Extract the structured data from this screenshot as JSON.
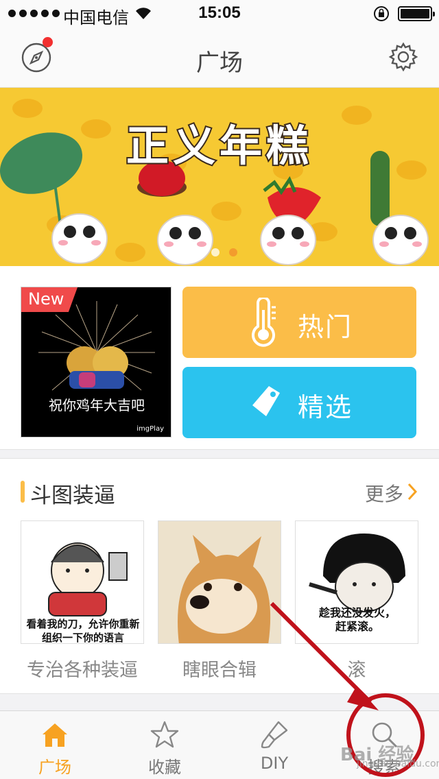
{
  "status_bar": {
    "carrier": "中国电信",
    "time": "15:05"
  },
  "navbar": {
    "title": "广场"
  },
  "banner": {
    "title": "正义年糕",
    "page_count": 3,
    "active_page": 3
  },
  "feature": {
    "new_tag": "New",
    "gif_caption": "祝你鸡年大吉吧",
    "gif_watermark": "imgPlay",
    "hot_label": "热门",
    "pick_label": "精选"
  },
  "section": {
    "title": "斗图装逼",
    "more_label": "更多",
    "items": [
      {
        "caption": "看着我的刀，允许你重新\n组织一下你的语言",
        "label": "专治各种装逼"
      },
      {
        "caption": "",
        "label": "瞎眼合辑"
      },
      {
        "caption": "趁我还没发火，\n赶紧滚。",
        "label": "滚"
      }
    ]
  },
  "tabbar": {
    "tabs": [
      {
        "label": "广场",
        "icon": "home-icon",
        "active": true
      },
      {
        "label": "收藏",
        "icon": "star-icon",
        "active": false
      },
      {
        "label": "DIY",
        "icon": "brush-icon",
        "active": false
      },
      {
        "label": "搜索",
        "icon": "search-icon",
        "active": false
      }
    ]
  },
  "colors": {
    "accent": "#f7a221",
    "hot": "#fbbd48",
    "pick": "#2bc3ee",
    "annotation": "#c0121b"
  },
  "watermark": {
    "text": "Bai 经验",
    "sub": "jingyan.baidu.com"
  }
}
